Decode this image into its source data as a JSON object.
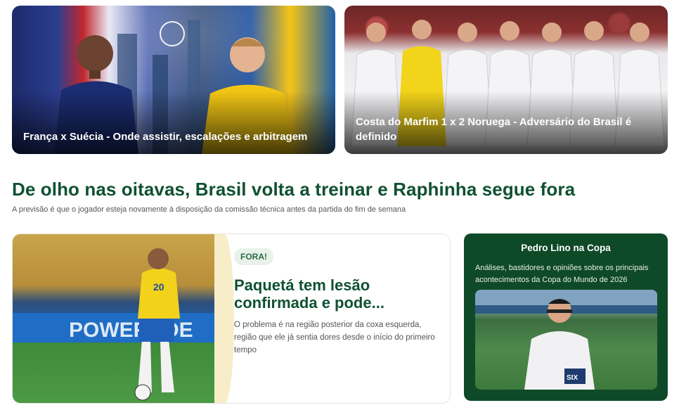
{
  "cards": [
    {
      "title": "França x Suécia - Onde assistir, escalações e arbitragem"
    },
    {
      "title": "Costa do Marfim 1 x 2 Noruega - Adversário do Brasil é definido"
    }
  ],
  "headline": {
    "title": "De olho nas oitavas, Brasil volta a treinar e Raphinha segue fora",
    "subtitle": "A previsão é que o jogador esteja novamente à disposição da comissão técnica antes da partida do fim de semana"
  },
  "feature": {
    "tag": "FORA!",
    "title": "Paquetá tem lesão confirmada e pode...",
    "description": "O problema é na região posterior da coxa esquerda, região que ele já sentia dores desde o início do primeiro tempo",
    "photo_board_text": "POWERADE",
    "player_number": "20"
  },
  "panel": {
    "title": "Pedro Lino na Copa",
    "description": "Análises, bastidores e opiniões sobre os principais acontecimentos da Copa do Mundo de 2026",
    "photo_shirt_text": "SIX"
  },
  "colors": {
    "brand_green": "#0f5133",
    "panel_green": "#0f4a28"
  }
}
